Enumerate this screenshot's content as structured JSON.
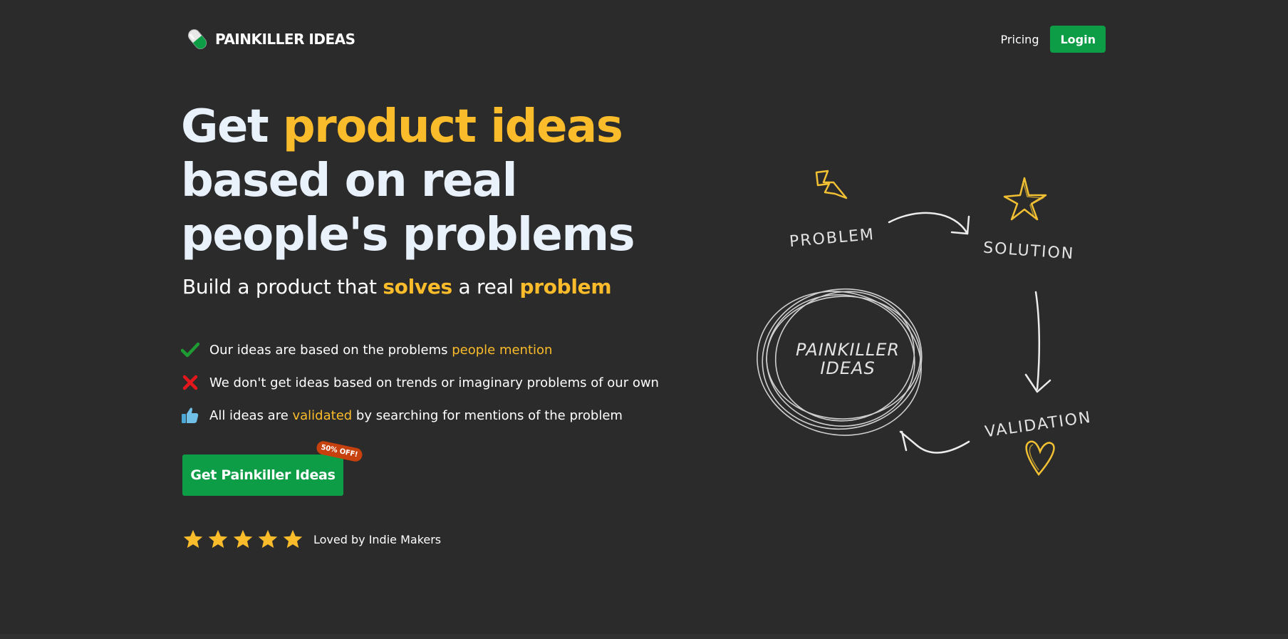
{
  "header": {
    "brand_name": "PAINKILLER IDEAS",
    "nav": {
      "pricing": "Pricing",
      "login": "Login"
    }
  },
  "hero": {
    "title_part1": "Get ",
    "title_accent": "product ideas",
    "title_part2": "based on real people's problems",
    "subtitle": {
      "part1": "Build a product that ",
      "accent1": "solves",
      "part2": " a real ",
      "accent2": "problem"
    },
    "features": [
      {
        "icon": "checkmark-icon",
        "text": "Our ideas are based on the problems ",
        "accent": "people mention",
        "after": ""
      },
      {
        "icon": "cross-icon",
        "text": "We don't get ideas based on trends or imaginary problems of our own",
        "accent": "",
        "after": ""
      },
      {
        "icon": "thumbs-up-icon",
        "text": "All ideas are ",
        "accent": "validated",
        "after": " by searching for mentions of the problem"
      }
    ],
    "cta": {
      "label": "Get Painkiller Ideas",
      "badge": "50% OFF!"
    },
    "rating": {
      "stars": 5,
      "text": "Loved by Indie Makers"
    }
  },
  "illustration": {
    "labels": {
      "problem": "PROBLEM",
      "solution": "SOLUTION",
      "validation": "VALIDATION",
      "core_line1": "PAINKILLER",
      "core_line2": "IDEAS"
    }
  },
  "colors": {
    "background": "#2b2b2b",
    "accent": "#fbbc2b",
    "brand_green": "#0d9d47",
    "badge": "#c6410d",
    "check": "#1e9b32",
    "cross": "#e3171c",
    "thumb": "#6fbfe7"
  }
}
